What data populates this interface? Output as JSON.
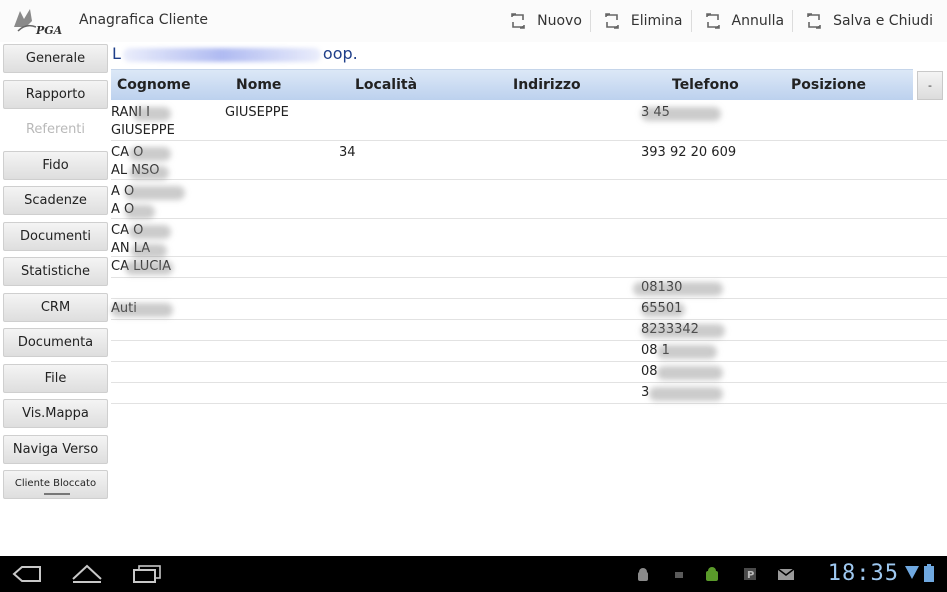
{
  "app": {
    "title": "Anagrafica Cliente"
  },
  "actions": [
    {
      "label": "Nuovo"
    },
    {
      "label": "Elimina"
    },
    {
      "label": "Annulla"
    },
    {
      "label": "Salva e Chiudi"
    }
  ],
  "sidebar": {
    "items": [
      {
        "label": "Generale"
      },
      {
        "label": "Rapporto"
      },
      {
        "label": "Referenti"
      },
      {
        "label": "Fido"
      },
      {
        "label": "Scadenze"
      },
      {
        "label": "Documenti"
      },
      {
        "label": "Statistiche"
      },
      {
        "label": "CRM"
      },
      {
        "label": "Documenta"
      },
      {
        "label": "File"
      },
      {
        "label": "Vis.Mappa"
      },
      {
        "label": "Naviga Verso"
      },
      {
        "label": "Cliente Bloccato"
      }
    ]
  },
  "client": {
    "name_start": "L",
    "name_end": "oop."
  },
  "table": {
    "columns": [
      "Cognome",
      "Nome",
      "Località",
      "Indirizzo",
      "Telefono",
      "Posizione"
    ],
    "minus_label": "-",
    "rows": [
      {
        "cognome": "RANI  I\nGIUSEPPE",
        "nome": "GIUSEPPE",
        "localita": "",
        "indirizzo": "",
        "telefono": "3       45",
        "posizione": ""
      },
      {
        "cognome": "CA    O\nAL    NSO",
        "nome": "",
        "localita": "34",
        "indirizzo": "",
        "telefono": "393 92 20 609",
        "posizione": ""
      },
      {
        "cognome": "A       O\nA    O",
        "nome": "",
        "localita": "",
        "indirizzo": "",
        "telefono": "",
        "posizione": ""
      },
      {
        "cognome": "CA    O\nAN      LA",
        "nome": "",
        "localita": "",
        "indirizzo": "",
        "telefono": "",
        "posizione": ""
      },
      {
        "cognome": "CA      LUCIA",
        "nome": "",
        "localita": "",
        "indirizzo": "",
        "telefono": "",
        "posizione": ""
      },
      {
        "cognome": "",
        "nome": "",
        "localita": "",
        "indirizzo": "",
        "telefono": "08130",
        "posizione": ""
      },
      {
        "cognome": "Auti",
        "nome": "",
        "localita": "",
        "indirizzo": "",
        "telefono": "      65501",
        "posizione": ""
      },
      {
        "cognome": "",
        "nome": "",
        "localita": "",
        "indirizzo": "",
        "telefono": "  8233342",
        "posizione": ""
      },
      {
        "cognome": "",
        "nome": "",
        "localita": "",
        "indirizzo": "",
        "telefono": "08       1",
        "posizione": ""
      },
      {
        "cognome": "",
        "nome": "",
        "localita": "",
        "indirizzo": "",
        "telefono": "08        ",
        "posizione": ""
      },
      {
        "cognome": "",
        "nome": "",
        "localita": "",
        "indirizzo": "",
        "telefono": "3         ",
        "posizione": ""
      }
    ]
  },
  "system": {
    "clock": "18:35"
  },
  "colors": {
    "accent": "#1f3f8a",
    "header_bg": "#c8daf2",
    "clock": "#9ec8f0"
  }
}
